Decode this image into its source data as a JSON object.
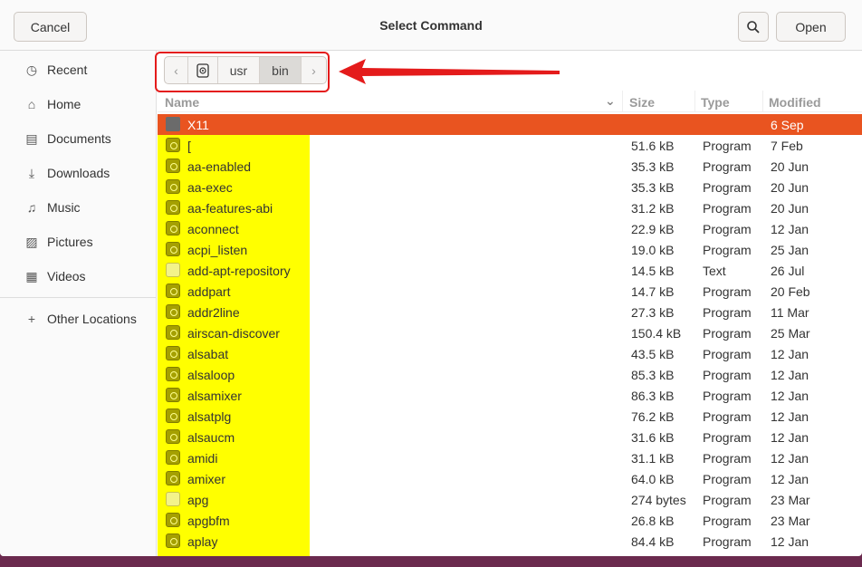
{
  "header": {
    "cancel": "Cancel",
    "title": "Select Command",
    "open": "Open"
  },
  "sidebar": [
    {
      "label": "Recent",
      "icon": "clock-icon"
    },
    {
      "label": "Home",
      "icon": "home-icon"
    },
    {
      "label": "Documents",
      "icon": "document-icon"
    },
    {
      "label": "Downloads",
      "icon": "download-icon"
    },
    {
      "label": "Music",
      "icon": "music-icon"
    },
    {
      "label": "Pictures",
      "icon": "picture-icon"
    },
    {
      "label": "Videos",
      "icon": "video-icon"
    }
  ],
  "other_locations": "Other Locations",
  "path": {
    "segments": [
      "usr",
      "bin"
    ]
  },
  "columns": {
    "name": "Name",
    "size": "Size",
    "type": "Type",
    "modified": "Modified"
  },
  "files": [
    {
      "name": "X11",
      "size": "",
      "type": "",
      "modified": "6 Sep",
      "kind": "folder"
    },
    {
      "name": "[",
      "size": "51.6 kB",
      "type": "Program",
      "modified": "7 Feb",
      "kind": "prog"
    },
    {
      "name": "aa-enabled",
      "size": "35.3 kB",
      "type": "Program",
      "modified": "20 Jun",
      "kind": "prog"
    },
    {
      "name": "aa-exec",
      "size": "35.3 kB",
      "type": "Program",
      "modified": "20 Jun",
      "kind": "prog"
    },
    {
      "name": "aa-features-abi",
      "size": "31.2 kB",
      "type": "Program",
      "modified": "20 Jun",
      "kind": "prog"
    },
    {
      "name": "aconnect",
      "size": "22.9 kB",
      "type": "Program",
      "modified": "12 Jan",
      "kind": "prog"
    },
    {
      "name": "acpi_listen",
      "size": "19.0 kB",
      "type": "Program",
      "modified": "25 Jan",
      "kind": "prog"
    },
    {
      "name": "add-apt-repository",
      "size": "14.5 kB",
      "type": "Text",
      "modified": "26 Jul",
      "kind": "text"
    },
    {
      "name": "addpart",
      "size": "14.7 kB",
      "type": "Program",
      "modified": "20 Feb",
      "kind": "prog"
    },
    {
      "name": "addr2line",
      "size": "27.3 kB",
      "type": "Program",
      "modified": "11 Mar",
      "kind": "prog"
    },
    {
      "name": "airscan-discover",
      "size": "150.4 kB",
      "type": "Program",
      "modified": "25 Mar",
      "kind": "prog"
    },
    {
      "name": "alsabat",
      "size": "43.5 kB",
      "type": "Program",
      "modified": "12 Jan",
      "kind": "prog"
    },
    {
      "name": "alsaloop",
      "size": "85.3 kB",
      "type": "Program",
      "modified": "12 Jan",
      "kind": "prog"
    },
    {
      "name": "alsamixer",
      "size": "86.3 kB",
      "type": "Program",
      "modified": "12 Jan",
      "kind": "prog"
    },
    {
      "name": "alsatplg",
      "size": "76.2 kB",
      "type": "Program",
      "modified": "12 Jan",
      "kind": "prog"
    },
    {
      "name": "alsaucm",
      "size": "31.6 kB",
      "type": "Program",
      "modified": "12 Jan",
      "kind": "prog"
    },
    {
      "name": "amidi",
      "size": "31.1 kB",
      "type": "Program",
      "modified": "12 Jan",
      "kind": "prog"
    },
    {
      "name": "amixer",
      "size": "64.0 kB",
      "type": "Program",
      "modified": "12 Jan",
      "kind": "prog"
    },
    {
      "name": "apg",
      "size": "274 bytes",
      "type": "Program",
      "modified": "23 Mar",
      "kind": "text"
    },
    {
      "name": "apgbfm",
      "size": "26.8 kB",
      "type": "Program",
      "modified": "23 Mar",
      "kind": "prog"
    },
    {
      "name": "aplay",
      "size": "84.4 kB",
      "type": "Program",
      "modified": "12 Jan",
      "kind": "prog"
    }
  ]
}
